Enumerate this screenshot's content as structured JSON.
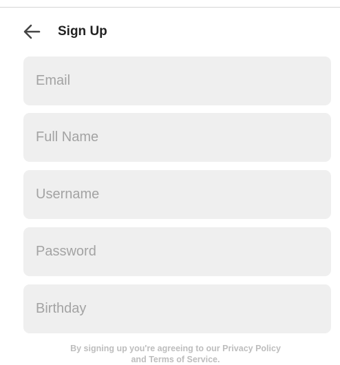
{
  "header": {
    "title": "Sign Up",
    "back_icon": "arrow-left-icon"
  },
  "form": {
    "email": {
      "placeholder": "Email",
      "value": ""
    },
    "full_name": {
      "placeholder": "Full Name",
      "value": ""
    },
    "username": {
      "placeholder": "Username",
      "value": ""
    },
    "password": {
      "placeholder": "Password",
      "value": ""
    },
    "birthday": {
      "placeholder": "Birthday",
      "value": ""
    }
  },
  "legal": {
    "prefix": "By signing up you're agreeing to our ",
    "privacy_link": "Privacy Policy",
    "middle": "and ",
    "terms_link": "Terms of Service",
    "suffix": "."
  },
  "colors": {
    "field_background": "#efefef",
    "placeholder": "#a3a3a3",
    "title": "#222222",
    "legal_text": "#bdbdbd"
  }
}
